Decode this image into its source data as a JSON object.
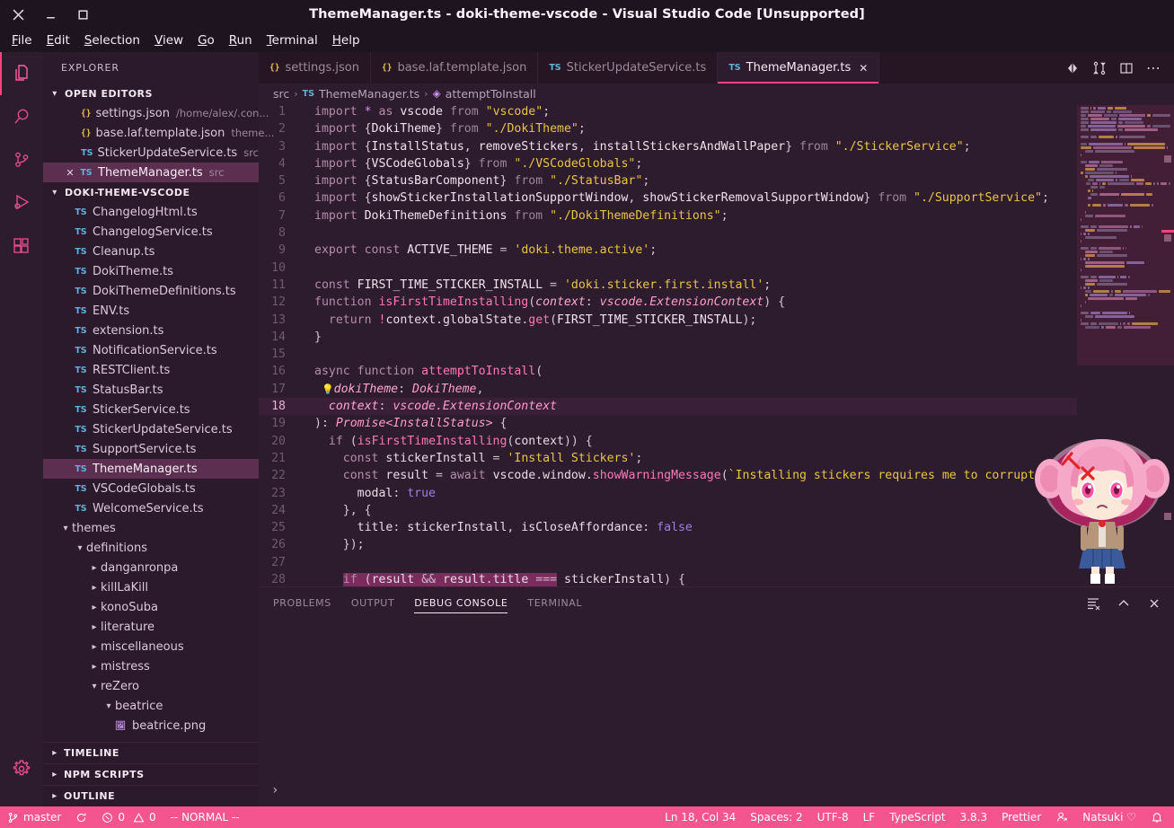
{
  "window": {
    "title": "ThemeManager.ts - doki-theme-vscode - Visual Studio Code [Unsupported]",
    "close_label": "✕",
    "minimize_label": "–",
    "maximize_label": "□"
  },
  "menubar": [
    {
      "label": "File",
      "mnemonic": "F"
    },
    {
      "label": "Edit",
      "mnemonic": "E"
    },
    {
      "label": "Selection",
      "mnemonic": "S"
    },
    {
      "label": "View",
      "mnemonic": "V"
    },
    {
      "label": "Go",
      "mnemonic": "G"
    },
    {
      "label": "Run",
      "mnemonic": "R"
    },
    {
      "label": "Terminal",
      "mnemonic": "T"
    },
    {
      "label": "Help",
      "mnemonic": "H"
    }
  ],
  "activitybar": {
    "items": [
      {
        "name": "explorer",
        "icon": "files-icon",
        "active": true
      },
      {
        "name": "search",
        "icon": "search-icon",
        "active": false
      },
      {
        "name": "source-control",
        "icon": "source-control-icon",
        "active": false
      },
      {
        "name": "run-and-debug",
        "icon": "run-debug-icon",
        "active": false
      },
      {
        "name": "extensions",
        "icon": "extensions-icon",
        "active": false
      }
    ],
    "bottom": [
      {
        "name": "manage",
        "icon": "gear-icon"
      }
    ]
  },
  "sidebar": {
    "title": "EXPLORER",
    "open_editors": {
      "header": "OPEN EDITORS",
      "items": [
        {
          "name": "settings.json",
          "desc": "/home/alex/.con...",
          "icon": "json-icon",
          "selected": false,
          "closeable": false
        },
        {
          "name": "base.laf.template.json",
          "desc": "theme...",
          "icon": "json-icon",
          "selected": false,
          "closeable": false
        },
        {
          "name": "StickerUpdateService.ts",
          "desc": "src",
          "icon": "ts-icon",
          "selected": false,
          "closeable": false
        },
        {
          "name": "ThemeManager.ts",
          "desc": "src",
          "icon": "ts-icon",
          "selected": true,
          "closeable": true
        }
      ]
    },
    "project": {
      "header": "DOKI-THEME-VSCODE",
      "files": [
        {
          "name": "ChangelogHtml.ts",
          "type": "ts",
          "indent": 1
        },
        {
          "name": "ChangelogService.ts",
          "type": "ts",
          "indent": 1
        },
        {
          "name": "Cleanup.ts",
          "type": "ts",
          "indent": 1
        },
        {
          "name": "DokiTheme.ts",
          "type": "ts",
          "indent": 1
        },
        {
          "name": "DokiThemeDefinitions.ts",
          "type": "ts",
          "indent": 1
        },
        {
          "name": "ENV.ts",
          "type": "ts",
          "indent": 1
        },
        {
          "name": "extension.ts",
          "type": "ts",
          "indent": 1
        },
        {
          "name": "NotificationService.ts",
          "type": "ts",
          "indent": 1
        },
        {
          "name": "RESTClient.ts",
          "type": "ts",
          "indent": 1
        },
        {
          "name": "StatusBar.ts",
          "type": "ts",
          "indent": 1
        },
        {
          "name": "StickerService.ts",
          "type": "ts",
          "indent": 1
        },
        {
          "name": "StickerUpdateService.ts",
          "type": "ts",
          "indent": 1
        },
        {
          "name": "SupportService.ts",
          "type": "ts",
          "indent": 1
        },
        {
          "name": "ThemeManager.ts",
          "type": "ts",
          "indent": 1,
          "selected": true
        },
        {
          "name": "VSCodeGlobals.ts",
          "type": "ts",
          "indent": 1
        },
        {
          "name": "WelcomeService.ts",
          "type": "ts",
          "indent": 1
        },
        {
          "name": "themes",
          "type": "folder-open",
          "indent": 0
        },
        {
          "name": "definitions",
          "type": "folder-open",
          "indent": 1
        },
        {
          "name": "danganronpa",
          "type": "folder",
          "indent": 2
        },
        {
          "name": "killLaKill",
          "type": "folder",
          "indent": 2
        },
        {
          "name": "konoSuba",
          "type": "folder",
          "indent": 2
        },
        {
          "name": "literature",
          "type": "folder",
          "indent": 2
        },
        {
          "name": "miscellaneous",
          "type": "folder",
          "indent": 2
        },
        {
          "name": "mistress",
          "type": "folder",
          "indent": 2
        },
        {
          "name": "reZero",
          "type": "folder-open",
          "indent": 2
        },
        {
          "name": "beatrice",
          "type": "folder-open",
          "indent": 3
        },
        {
          "name": "beatrice.png",
          "type": "png",
          "indent": 4
        }
      ]
    },
    "bottom_sections": [
      {
        "label": "TIMELINE"
      },
      {
        "label": "NPM SCRIPTS"
      },
      {
        "label": "OUTLINE"
      }
    ]
  },
  "tabs": [
    {
      "label": "settings.json",
      "icon": "json-icon",
      "active": false,
      "closeable": false
    },
    {
      "label": "base.laf.template.json",
      "icon": "json-icon",
      "active": false,
      "closeable": false
    },
    {
      "label": "StickerUpdateService.ts",
      "icon": "ts-icon",
      "active": false,
      "closeable": false
    },
    {
      "label": "ThemeManager.ts",
      "icon": "ts-icon",
      "active": true,
      "closeable": true
    }
  ],
  "tab_actions": [
    {
      "name": "run-code-icon",
      "glyph": "◆"
    },
    {
      "name": "split-diff-icon",
      "glyph": "⇅"
    },
    {
      "name": "split-editor-icon",
      "glyph": "◫"
    },
    {
      "name": "more-actions-icon",
      "glyph": "⋯"
    }
  ],
  "breadcrumb": {
    "parts": [
      "src",
      "ThemeManager.ts",
      "attemptToInstall"
    ],
    "separator": "›"
  },
  "editor": {
    "first_line": 1,
    "lines": [
      {
        "n": 1,
        "code": "import * as vscode from \"vscode\";"
      },
      {
        "n": 2,
        "code": "import {DokiTheme} from \"./DokiTheme\";"
      },
      {
        "n": 3,
        "code": "import {InstallStatus, removeStickers, installStickersAndWallPaper} from \"./StickerService\";"
      },
      {
        "n": 4,
        "code": "import {VSCodeGlobals} from \"./VSCodeGlobals\";"
      },
      {
        "n": 5,
        "code": "import {StatusBarComponent} from \"./StatusBar\";"
      },
      {
        "n": 6,
        "code": "import {showStickerInstallationSupportWindow, showStickerRemovalSupportWindow} from \"./SupportService\";"
      },
      {
        "n": 7,
        "code": "import DokiThemeDefinitions from \"./DokiThemeDefinitions\";"
      },
      {
        "n": 8,
        "code": ""
      },
      {
        "n": 9,
        "code": "export const ACTIVE_THEME = 'doki.theme.active';"
      },
      {
        "n": 10,
        "code": ""
      },
      {
        "n": 11,
        "code": "const FIRST_TIME_STICKER_INSTALL = 'doki.sticker.first.install';"
      },
      {
        "n": 12,
        "code": "function isFirstTimeInstalling(context: vscode.ExtensionContext) {"
      },
      {
        "n": 13,
        "code": "  return !context.globalState.get(FIRST_TIME_STICKER_INSTALL);"
      },
      {
        "n": 14,
        "code": "}"
      },
      {
        "n": 15,
        "code": ""
      },
      {
        "n": 16,
        "code": "async function attemptToInstall("
      },
      {
        "n": 17,
        "code": "  dokiTheme: DokiTheme,"
      },
      {
        "n": 18,
        "code": "  context: vscode.ExtensionContext"
      },
      {
        "n": 19,
        "code": "): Promise<InstallStatus> {"
      },
      {
        "n": 20,
        "code": "  if (isFirstTimeInstalling(context)) {"
      },
      {
        "n": 21,
        "code": "    const stickerInstall = 'Install Stickers';"
      },
      {
        "n": 22,
        "code": "    const result = await vscode.window.showWarningMessage(`Installing stickers requires me to corrupt VS"
      },
      {
        "n": 23,
        "code": "      modal: true"
      },
      {
        "n": 24,
        "code": "    }, {"
      },
      {
        "n": 25,
        "code": "      title: stickerInstall, isCloseAffordance: false"
      },
      {
        "n": 26,
        "code": "    });"
      },
      {
        "n": 27,
        "code": ""
      },
      {
        "n": 28,
        "code": "    if (result && result.title === stickerInstall) {"
      }
    ]
  },
  "panel": {
    "tabs": [
      {
        "label": "PROBLEMS",
        "active": false
      },
      {
        "label": "OUTPUT",
        "active": false
      },
      {
        "label": "DEBUG CONSOLE",
        "active": true
      },
      {
        "label": "TERMINAL",
        "active": false
      }
    ],
    "actions": [
      {
        "name": "clear-console-icon",
        "glyph": "≡"
      },
      {
        "name": "maximize-panel-icon",
        "glyph": "⌃"
      },
      {
        "name": "close-panel-icon",
        "glyph": "✕"
      }
    ],
    "prompt": "›"
  },
  "statusbar": {
    "left": [
      {
        "name": "branch",
        "icon": "source-control-icon",
        "label": "master"
      },
      {
        "name": "sync",
        "icon": "sync-icon",
        "label": ""
      },
      {
        "name": "problems",
        "icon": "error-warning-icon",
        "label": "0  0"
      },
      {
        "name": "vim-mode",
        "icon": "",
        "label": "-- NORMAL --"
      }
    ],
    "left_problems": {
      "errors": "0",
      "warnings": "0"
    },
    "right": [
      {
        "name": "cursor-position",
        "label": "Ln 18, Col 34"
      },
      {
        "name": "indentation",
        "label": "Spaces: 2"
      },
      {
        "name": "encoding",
        "label": "UTF-8"
      },
      {
        "name": "eol",
        "label": "LF"
      },
      {
        "name": "language-mode",
        "label": "TypeScript"
      },
      {
        "name": "ts-version",
        "label": "3.8.3"
      },
      {
        "name": "formatter",
        "label": "Prettier"
      },
      {
        "name": "remote-icon",
        "label": ""
      },
      {
        "name": "doki-theme",
        "label": "Natsuki ♡"
      },
      {
        "name": "notifications",
        "label": ""
      }
    ]
  },
  "colors": {
    "accent": "#ff4081",
    "statusbar_bg": "#f4558e",
    "editor_bg": "#2d1b2e",
    "sidebar_bg": "#2b192c",
    "titlebar_bg": "#1e1420",
    "selection": "#7a2c5c"
  }
}
